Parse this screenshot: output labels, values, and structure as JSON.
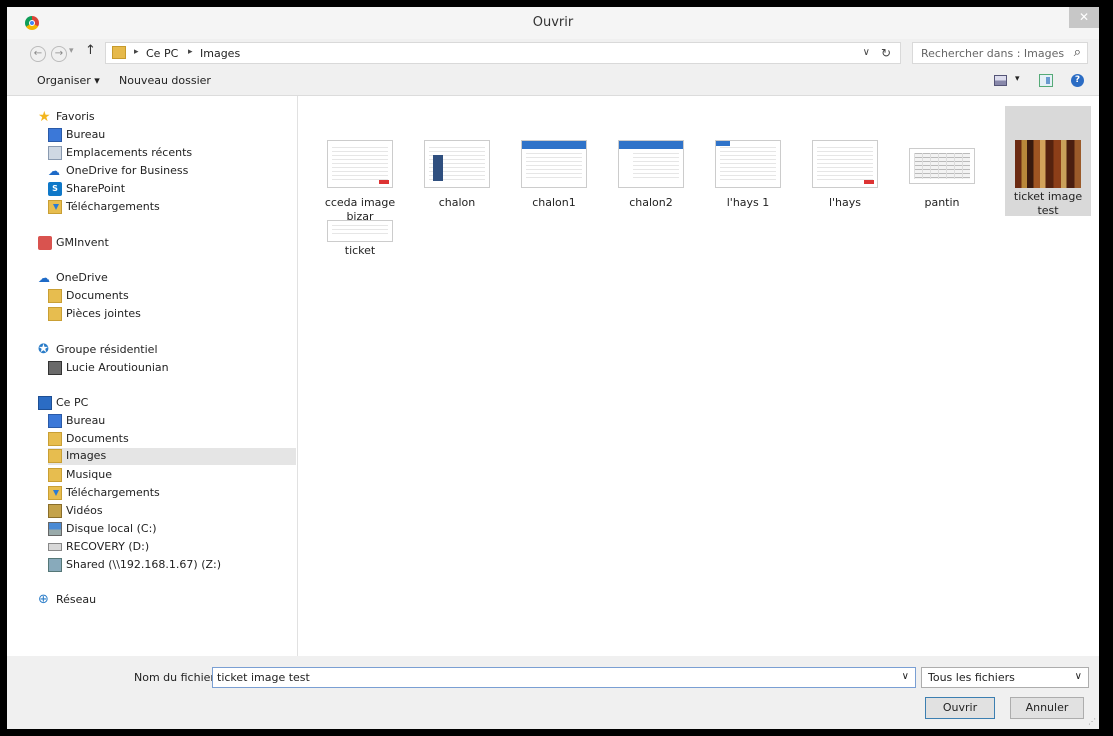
{
  "window": {
    "title": "Ouvrir",
    "close_glyph": "✕"
  },
  "address": {
    "crumbs": [
      "Ce PC",
      "Images"
    ],
    "separator": "▸",
    "search_placeholder": "Rechercher dans : Images"
  },
  "toolbar": {
    "organiser": "Organiser ▾",
    "new_folder": "Nouveau dossier"
  },
  "sidebar": {
    "items": [
      {
        "label": "Favoris",
        "icon": "star-icon"
      },
      {
        "label": "Bureau",
        "icon": "desktop-icon"
      },
      {
        "label": "Emplacements récents",
        "icon": "recent-places-icon"
      },
      {
        "label": "OneDrive for Business",
        "icon": "cloud-icon"
      },
      {
        "label": "SharePoint",
        "icon": "sharepoint-icon"
      },
      {
        "label": "Téléchargements",
        "icon": "download-folder-icon"
      },
      {
        "label": "GMInvent",
        "icon": "app-icon"
      },
      {
        "label": "OneDrive",
        "icon": "cloud-icon"
      },
      {
        "label": "Documents",
        "icon": "folder-icon"
      },
      {
        "label": "Pièces jointes",
        "icon": "folder-icon"
      },
      {
        "label": "Groupe résidentiel",
        "icon": "homegroup-icon"
      },
      {
        "label": "Lucie Aroutiounian",
        "icon": "user-icon"
      },
      {
        "label": "Ce PC",
        "icon": "computer-icon"
      },
      {
        "label": "Bureau",
        "icon": "desktop-icon"
      },
      {
        "label": "Documents",
        "icon": "documents-folder-icon"
      },
      {
        "label": "Images",
        "icon": "pictures-folder-icon"
      },
      {
        "label": "Musique",
        "icon": "music-folder-icon"
      },
      {
        "label": "Téléchargements",
        "icon": "download-folder-icon"
      },
      {
        "label": "Vidéos",
        "icon": "videos-folder-icon"
      },
      {
        "label": "Disque local (C:)",
        "icon": "local-disk-icon"
      },
      {
        "label": "RECOVERY (D:)",
        "icon": "drive-icon"
      },
      {
        "label": "Shared (\\\\192.168.1.67) (Z:)",
        "icon": "network-drive-icon"
      },
      {
        "label": "Réseau",
        "icon": "network-icon"
      }
    ]
  },
  "files": [
    {
      "name": "cceda image bizar",
      "thumb": "document"
    },
    {
      "name": "chalon",
      "thumb": "webpage"
    },
    {
      "name": "chalon1",
      "thumb": "webpage-blue"
    },
    {
      "name": "chalon2",
      "thumb": "webpage-blue"
    },
    {
      "name": "l'hays 1",
      "thumb": "document"
    },
    {
      "name": "l'hays",
      "thumb": "document"
    },
    {
      "name": "pantin",
      "thumb": "spreadsheet"
    },
    {
      "name": "ticket image test",
      "thumb": "books-photo",
      "selected": true
    },
    {
      "name": "ticket",
      "thumb": "document"
    }
  ],
  "bottom": {
    "filename_label": "Nom du fichier :",
    "filename_value": "ticket image test",
    "filter_value": "Tous les fichiers",
    "ok_label": "Ouvrir",
    "cancel_label": "Annuler"
  }
}
